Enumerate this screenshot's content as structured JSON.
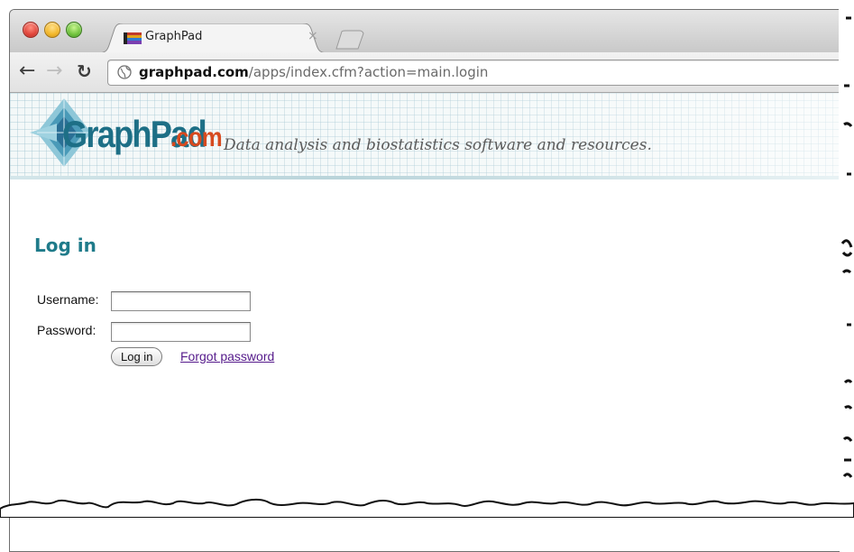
{
  "browser": {
    "tab_title": "GraphPad",
    "tab_close_glyph": "×",
    "url_host": "graphpad.com",
    "url_path": "/apps/index.cfm?action=main.login",
    "icons": {
      "back": "back-arrow-icon",
      "forward": "forward-arrow-icon",
      "reload": "reload-icon",
      "site": "globe-icon",
      "favicon": "graphpad-favicon"
    }
  },
  "header": {
    "logo_main": "GraphPad",
    "logo_suffix": ".com",
    "tagline": "Data analysis and biostatistics software and resources."
  },
  "login": {
    "title": "Log in",
    "username_label": "Username:",
    "username_value": "",
    "password_label": "Password:",
    "password_value": "",
    "submit_label": "Log in",
    "forgot_label": "Forgot password"
  },
  "colors": {
    "title_teal": "#1f7b8a",
    "link_visited": "#551a8b",
    "logo_blue": "#1d6f86",
    "logo_orange": "#d64a1f"
  }
}
